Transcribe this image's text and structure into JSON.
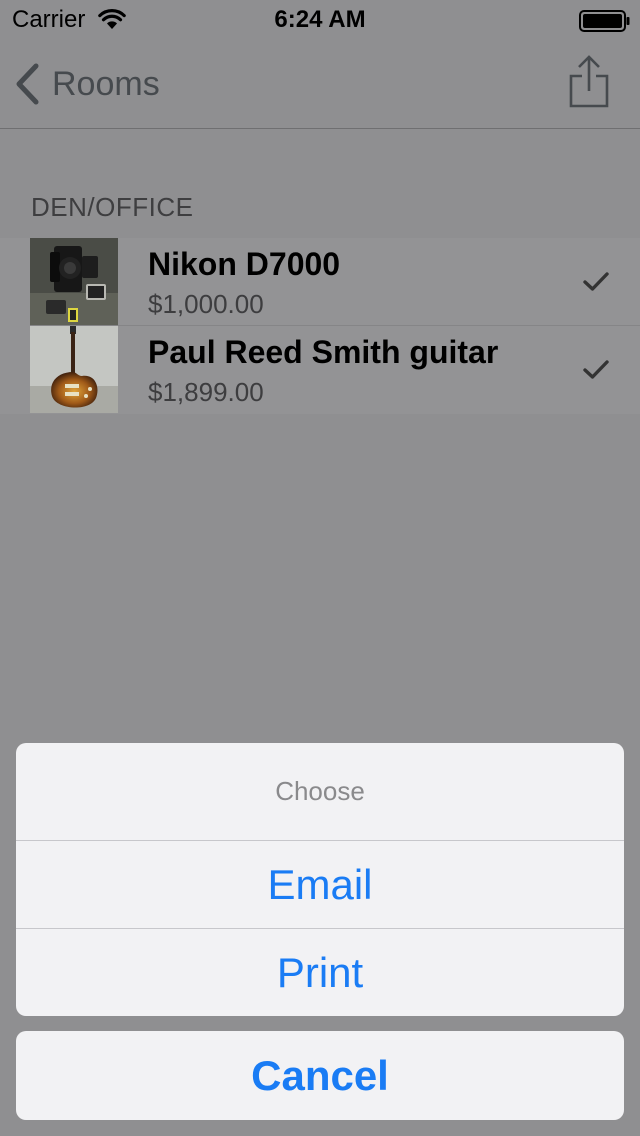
{
  "status_bar": {
    "carrier": "Carrier",
    "time": "6:24 AM"
  },
  "nav": {
    "back_label": "Rooms",
    "icons": {
      "back": "chevron-left-icon",
      "share": "share-icon"
    }
  },
  "section": {
    "header": "DEN/OFFICE",
    "items": [
      {
        "name": "Nikon D7000",
        "price": "$1,000.00",
        "checked": true,
        "thumbnail": "camera-photo"
      },
      {
        "name": "Paul Reed Smith guitar",
        "price": "$1,899.00",
        "checked": true,
        "thumbnail": "guitar-photo"
      }
    ]
  },
  "action_sheet": {
    "title": "Choose",
    "options": [
      "Email",
      "Print"
    ],
    "cancel_label": "Cancel"
  },
  "colors": {
    "accent": "#1a7cf4",
    "dim_background": "#8f8f91",
    "sheet_background": "#f2f2f4"
  }
}
